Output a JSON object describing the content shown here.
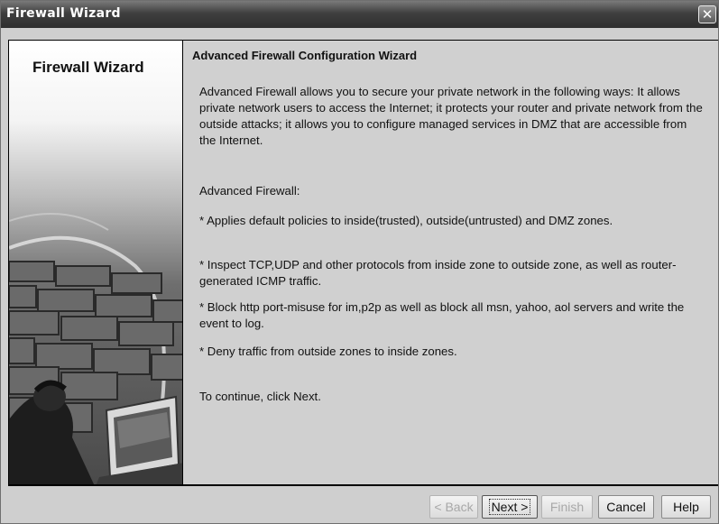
{
  "window": {
    "title": "Firewall Wizard",
    "close_glyph": "✕"
  },
  "sidebar": {
    "title": "Firewall Wizard",
    "illustration": "person-at-computer-by-brick-wall"
  },
  "main": {
    "heading": "Advanced Firewall Configuration Wizard",
    "intro": "Advanced Firewall allows you to secure your private network in the following ways: It allows private network users to access the Internet; it protects your router and private network from the outside attacks; it allows you to configure managed services in DMZ that are accessible from the Internet.",
    "features_label": "Advanced Firewall:",
    "features": [
      "* Applies default policies to inside(trusted), outside(untrusted) and DMZ zones.",
      "* Inspect TCP,UDP and other protocols from inside zone to outside zone, as well as router-generated ICMP traffic.",
      "* Block http port-misuse for im,p2p as well as block all msn, yahoo, aol servers and write the event to log.",
      "* Deny traffic from outside zones to inside zones."
    ],
    "continue_text": "To continue, click Next."
  },
  "buttons": {
    "back": "< Back",
    "next": "Next >",
    "finish": "Finish",
    "cancel": "Cancel",
    "help": "Help"
  }
}
